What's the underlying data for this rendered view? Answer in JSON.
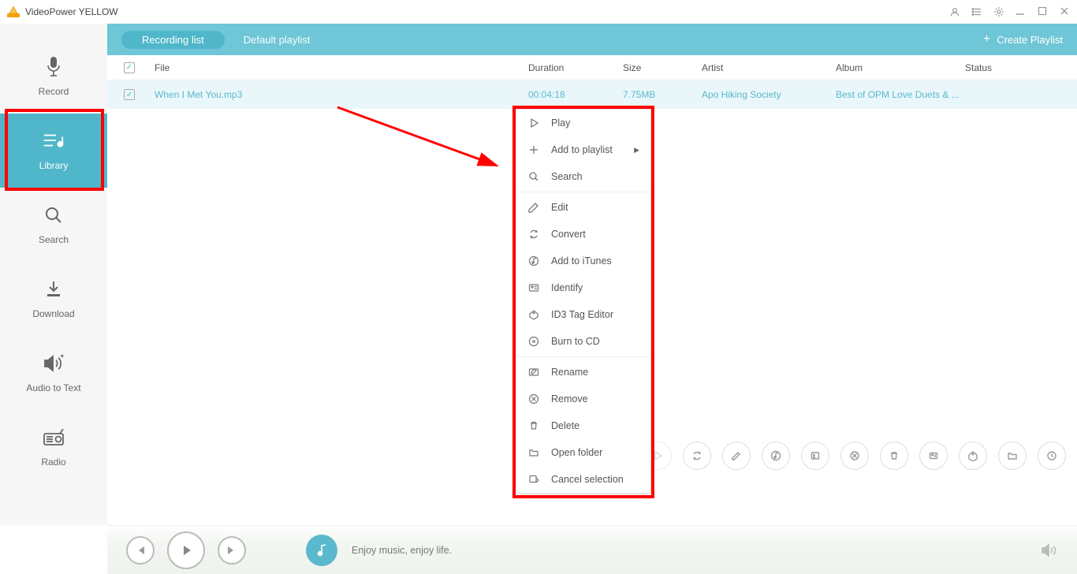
{
  "app": {
    "title": "VideoPower YELLOW"
  },
  "sidebar": {
    "items": [
      {
        "label": "Record"
      },
      {
        "label": "Library"
      },
      {
        "label": "Search"
      },
      {
        "label": "Download"
      },
      {
        "label": "Audio to Text"
      },
      {
        "label": "Radio"
      }
    ]
  },
  "tabs": {
    "recording": "Recording list",
    "default": "Default playlist",
    "create": "Create Playlist"
  },
  "columns": {
    "file": "File",
    "duration": "Duration",
    "size": "Size",
    "artist": "Artist",
    "album": "Album",
    "status": "Status"
  },
  "rows": [
    {
      "file": "When I Met You.mp3",
      "duration": "00:04:18",
      "size": "7.75MB",
      "artist": "Apo Hiking Society",
      "album": "Best of OPM Love Duets & ...",
      "status": ""
    }
  ],
  "contextmenu": {
    "play": "Play",
    "addplaylist": "Add to playlist",
    "search": "Search",
    "edit": "Edit",
    "convert": "Convert",
    "additunes": "Add to iTunes",
    "identify": "Identify",
    "id3": "ID3 Tag Editor",
    "burn": "Burn to CD",
    "rename": "Rename",
    "remove": "Remove",
    "delete": "Delete",
    "openfolder": "Open folder",
    "cancel": "Cancel selection"
  },
  "player": {
    "nowplaying": "Enjoy music, enjoy life."
  }
}
